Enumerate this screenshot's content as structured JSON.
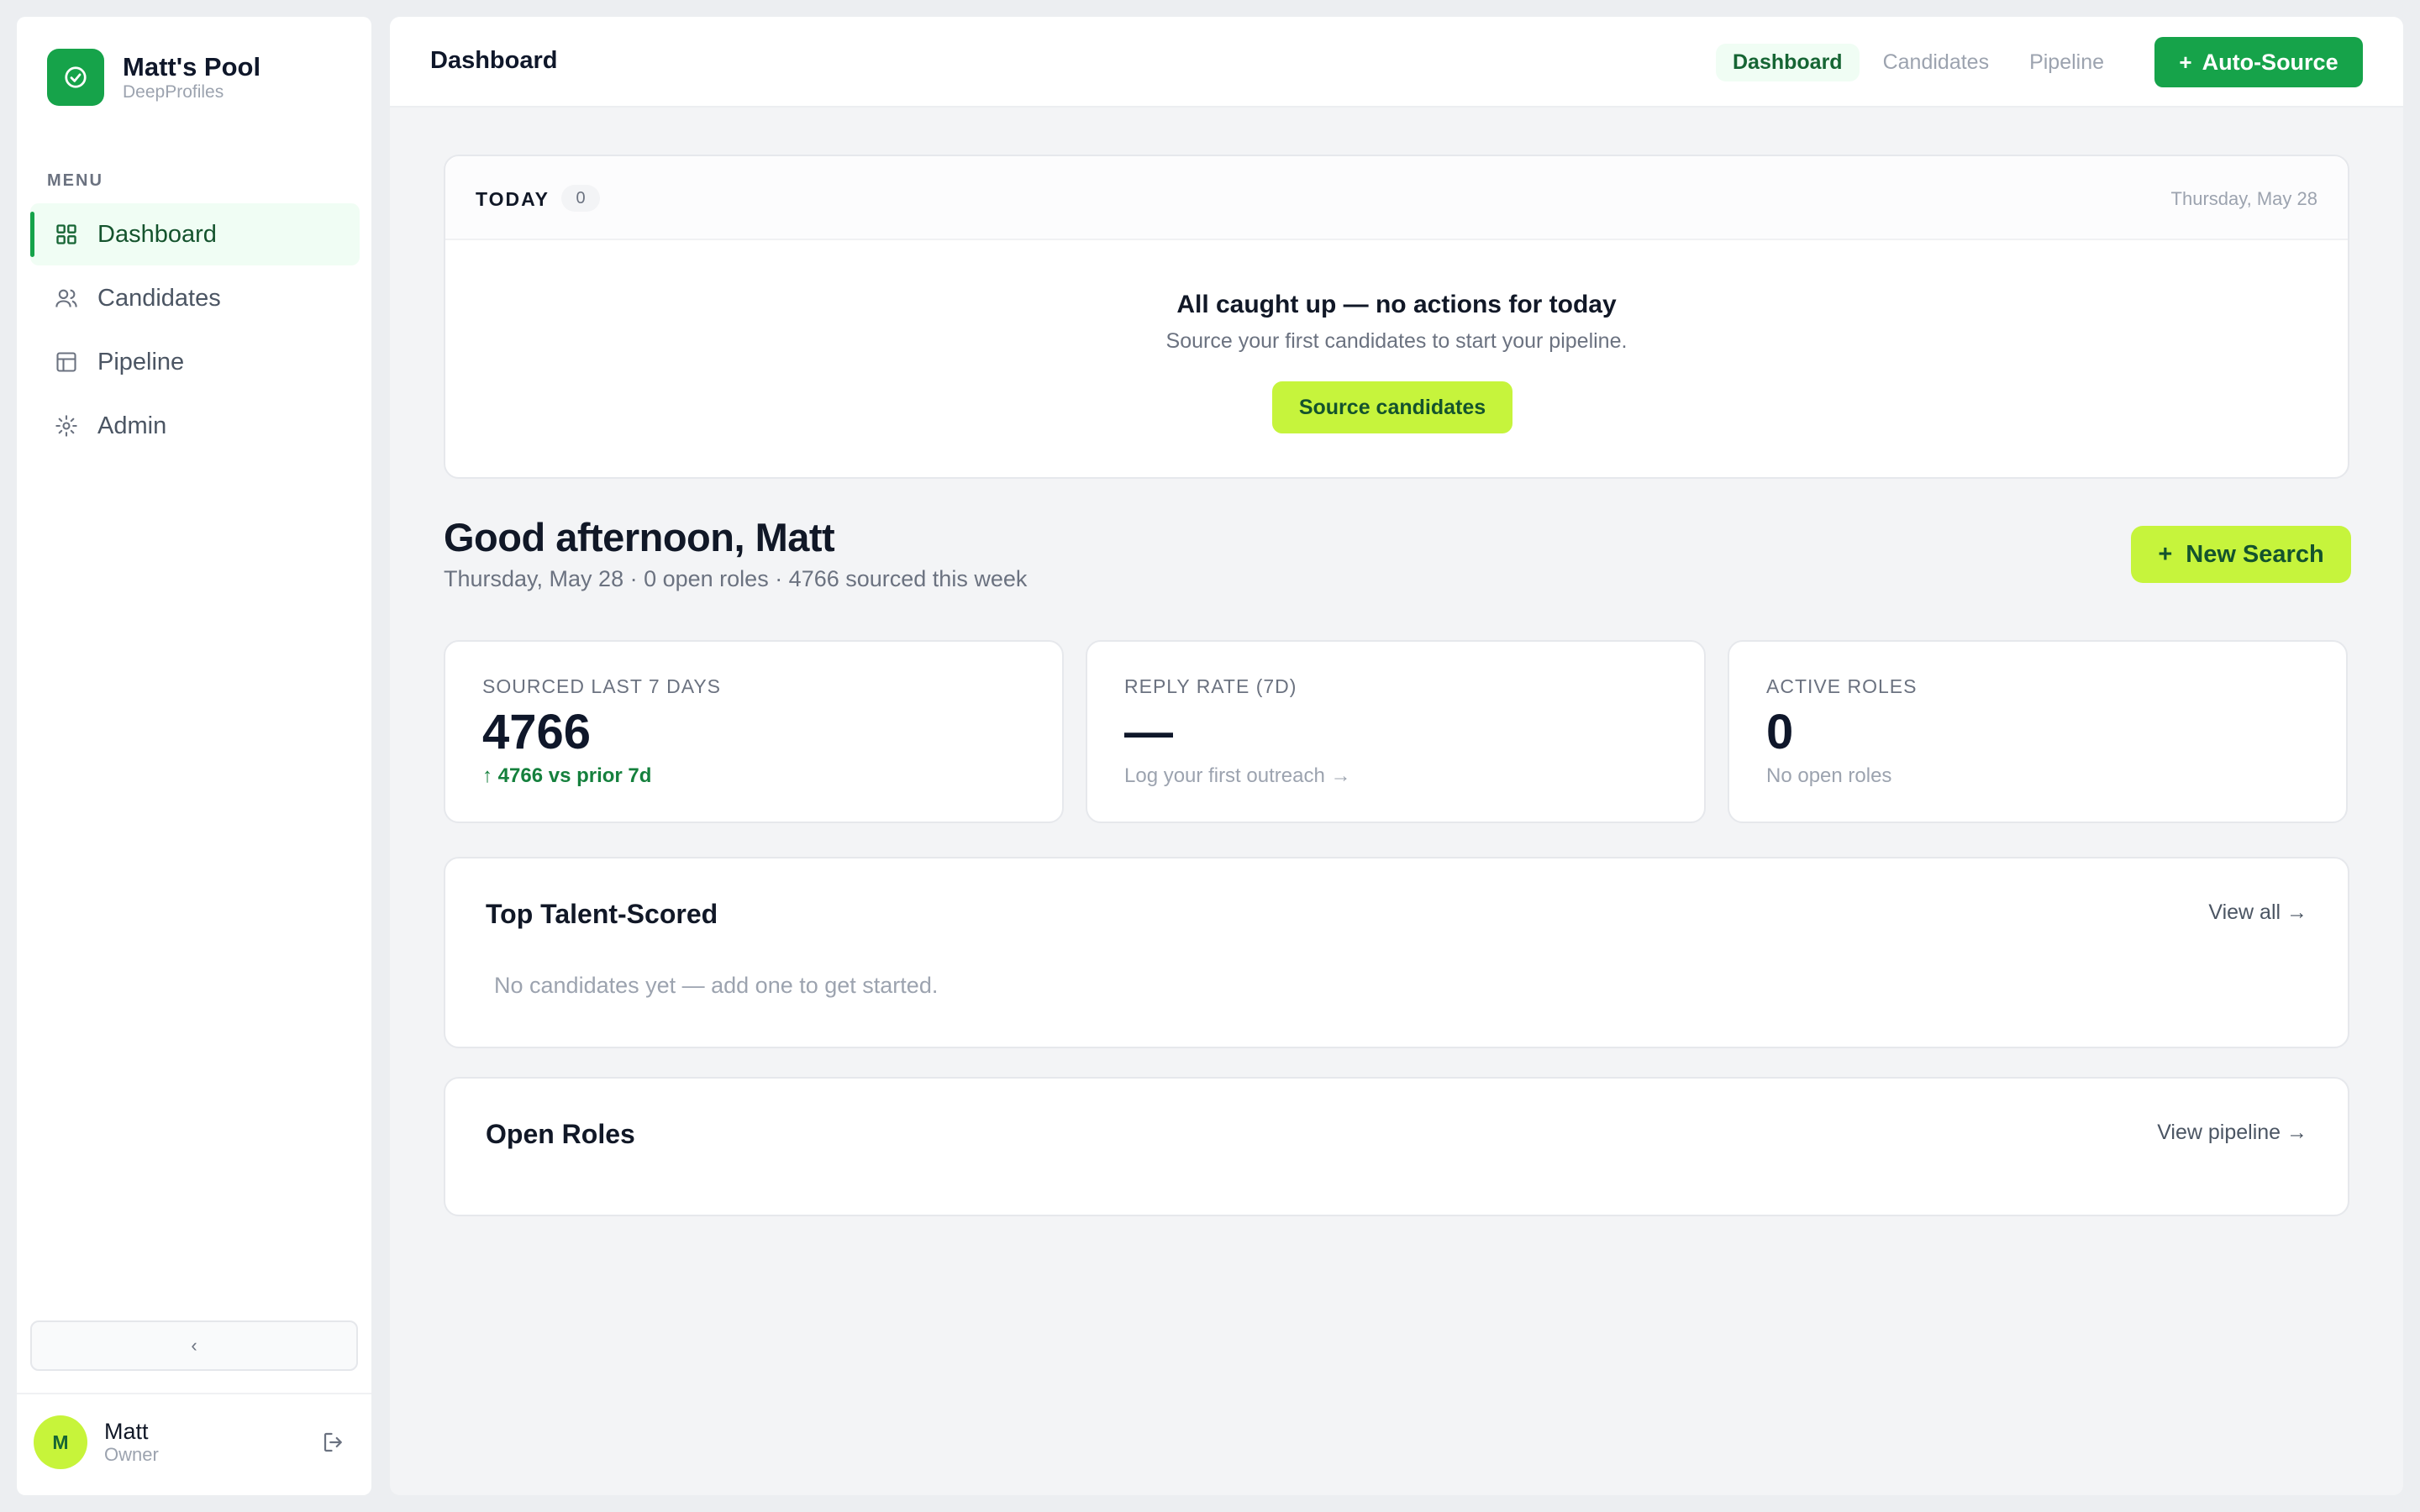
{
  "sidebar": {
    "brand_title": "Matt's Pool",
    "brand_subtitle": "DeepProfiles",
    "menu_label": "MENU",
    "items": [
      {
        "label": "Dashboard",
        "icon": "grid-icon",
        "active": true
      },
      {
        "label": "Candidates",
        "icon": "users-icon",
        "active": false
      },
      {
        "label": "Pipeline",
        "icon": "table-icon",
        "active": false
      },
      {
        "label": "Admin",
        "icon": "settings-icon",
        "active": false
      }
    ],
    "collapse_glyph": "‹",
    "user": {
      "initial": "M",
      "name": "Matt",
      "role": "Owner"
    }
  },
  "topbar": {
    "title": "Dashboard",
    "tabs": [
      {
        "label": "Dashboard",
        "active": true
      },
      {
        "label": "Candidates",
        "active": false
      },
      {
        "label": "Pipeline",
        "active": false
      }
    ],
    "auto_source_label": "Auto-Source"
  },
  "today": {
    "label": "TODAY",
    "count": "0",
    "date": "Thursday, May 28",
    "empty_title": "All caught up — no actions for today",
    "empty_subtitle": "Source your first candidates to start your pipeline.",
    "button_label": "Source candidates"
  },
  "greeting": {
    "title": "Good afternoon, Matt",
    "subtitle": "Thursday, May 28 · 0 open roles · 4766 sourced this week",
    "new_search_label": "New Search"
  },
  "stats": [
    {
      "label": "SOURCED LAST 7 DAYS",
      "value": "4766",
      "note": "↑ 4766 vs prior 7d"
    },
    {
      "label": "REPLY RATE (7D)",
      "value": "—",
      "note": "Log your first outreach →"
    },
    {
      "label": "ACTIVE ROLES",
      "value": "0",
      "note": "No open roles"
    }
  ],
  "talent": {
    "title": "Top Talent-Scored",
    "link": "View all →",
    "empty": "No candidates yet — add one to get started."
  },
  "roles": {
    "title": "Open Roles",
    "link": "View pipeline →"
  },
  "colors": {
    "brand_green": "#16a34a",
    "lime_accent": "#c6f43c",
    "active_bg": "#f0fdf4"
  }
}
